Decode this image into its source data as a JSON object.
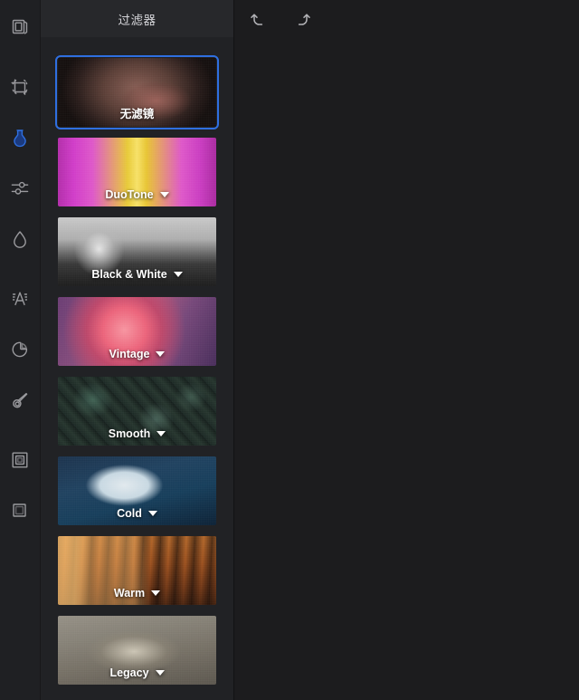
{
  "toolbar": {
    "tools": [
      {
        "name": "image-icon",
        "label": "Image"
      },
      {
        "name": "crop-rotate-icon",
        "label": "Crop & Rotate"
      },
      {
        "name": "filter-icon",
        "label": "Filters",
        "active": true
      },
      {
        "name": "adjust-sliders-icon",
        "label": "Adjust"
      },
      {
        "name": "droplet-icon",
        "label": "Retouch"
      },
      {
        "name": "text-icon",
        "label": "Text"
      },
      {
        "name": "sticker-icon",
        "label": "Sticker"
      },
      {
        "name": "brush-icon",
        "label": "Brush"
      },
      {
        "name": "frame-icon",
        "label": "Frame"
      },
      {
        "name": "border-icon",
        "label": "Border"
      }
    ]
  },
  "panel": {
    "title": "过滤器"
  },
  "history": {
    "undo_label": "撤销",
    "redo_label": "重做"
  },
  "filters": [
    {
      "id": "none",
      "label": "无滤镜",
      "art": "art-none",
      "selected": true,
      "has_caret": false
    },
    {
      "id": "duotone",
      "label": "DuoTone",
      "art": "art-duotone",
      "selected": false,
      "has_caret": true
    },
    {
      "id": "bw",
      "label": "Black & White",
      "art": "art-bw",
      "selected": false,
      "has_caret": true
    },
    {
      "id": "vintage",
      "label": "Vintage",
      "art": "art-vintage",
      "selected": false,
      "has_caret": true
    },
    {
      "id": "smooth",
      "label": "Smooth",
      "art": "art-smooth",
      "selected": false,
      "has_caret": true
    },
    {
      "id": "cold",
      "label": "Cold",
      "art": "art-cold",
      "selected": false,
      "has_caret": true
    },
    {
      "id": "warm",
      "label": "Warm",
      "art": "art-warm",
      "selected": false,
      "has_caret": true
    },
    {
      "id": "legacy",
      "label": "Legacy",
      "art": "art-legacy",
      "selected": false,
      "has_caret": true
    }
  ],
  "colors": {
    "accent": "#2f6fe0",
    "rail_bg": "#1f2023",
    "panel_bg": "#212225",
    "header_bg": "#27282b",
    "canvas_bg": "#1c1c1e",
    "label_text": "#ffffff",
    "icon_stroke": "#9a9a9e"
  }
}
